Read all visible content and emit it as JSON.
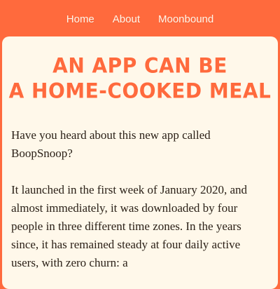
{
  "nav": {
    "items": [
      {
        "label": "Home"
      },
      {
        "label": "About"
      },
      {
        "label": "Moonbound"
      }
    ]
  },
  "article": {
    "title_line1": "AN APP CAN BE",
    "title_line2": "A HOME-COOKED MEAL",
    "paragraphs": [
      "Have you heard about this new app called BoopSnoop?",
      "It launched in the first week of January 2020, and almost immediately, it was downloaded by four people in three different time zones. In the years since, it has remained steady at four daily active users, with zero churn: a"
    ]
  },
  "colors": {
    "accent": "#ff6a3d",
    "card_bg": "#fff8ea",
    "text": "#2b2118",
    "nav_text": "#fff6ea"
  }
}
